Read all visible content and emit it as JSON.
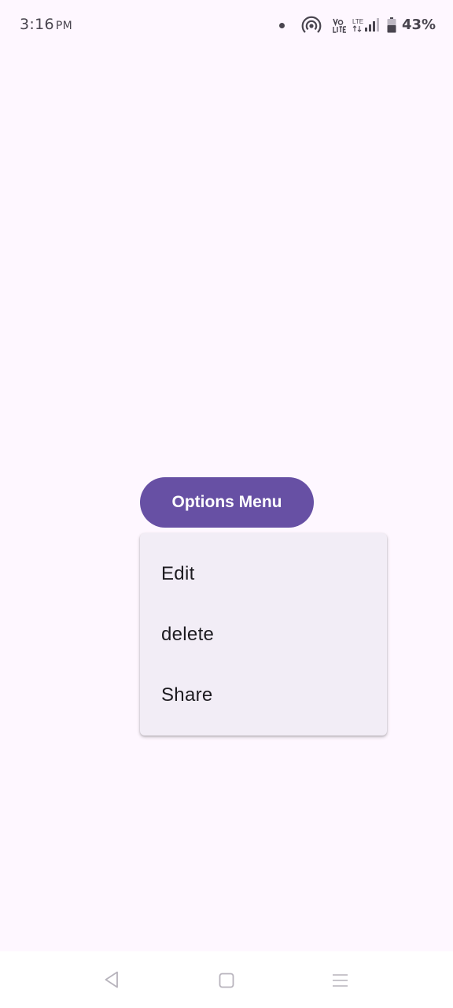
{
  "status_bar": {
    "time": "3:16",
    "ampm": "PM",
    "network_type": "LTE",
    "battery_percent": "43%",
    "icons": [
      "notification-dot-icon",
      "hotspot-icon",
      "volte-icon",
      "lte-signal-icon",
      "battery-icon"
    ]
  },
  "main": {
    "options_button_label": "Options Menu"
  },
  "menu": {
    "items": [
      {
        "label": "Edit"
      },
      {
        "label": "delete"
      },
      {
        "label": "Share"
      }
    ]
  },
  "nav_bar": {
    "icons": [
      "back-icon",
      "home-icon",
      "menu-icon"
    ]
  },
  "colors": {
    "background": "#FEF7FF",
    "primary": "#6750A4",
    "menu_surface": "#F2EDF6",
    "on_surface": "#1D1B20",
    "status_icons": "#49454F"
  }
}
